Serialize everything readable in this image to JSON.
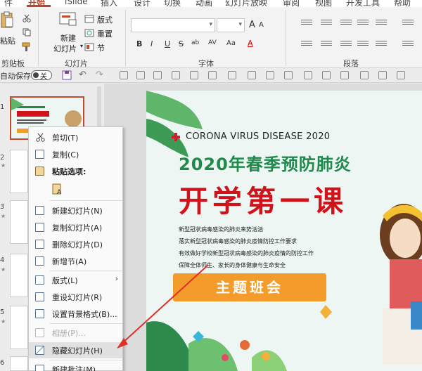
{
  "tabs": [
    "开始",
    "iSlide",
    "插入",
    "设计",
    "切换",
    "动画",
    "幻灯片放映",
    "审阅",
    "视图",
    "开发工具",
    "帮助"
  ],
  "ribbon": {
    "paste_label": "粘贴",
    "new_slide_label": [
      "新建",
      "幻灯片"
    ],
    "layout_label": "版式",
    "reset_label": "重置",
    "section_label": "节",
    "group_clipboard": "剪贴板",
    "group_slides": "幻灯片",
    "group_font": "字体",
    "group_paragraph": "段落",
    "format_buttons": [
      "B",
      "I",
      "U",
      "S",
      "ab",
      "AV",
      "Aa",
      "A"
    ]
  },
  "qat": {
    "autosave_label": "自动保存",
    "autosave_state": "关"
  },
  "slide_numbers": [
    "1",
    "2",
    "3",
    "4",
    "5",
    "6"
  ],
  "slide": {
    "banner": "CORONA VIRUS DISEASE 2020",
    "subtitle": "2020年春季预防肺炎",
    "title": "开学第一课",
    "lines": [
      "新型冠状病毒感染的肺炎来势汹汹",
      "落实新型冠状病毒感染的肺炎疫情防控工作要求",
      "有效做好学校新型冠状病毒感染的肺炎疫情的防控工作",
      "保障全体师生、家长的身体健康与生命安全"
    ],
    "button": "主题班会"
  },
  "menu": {
    "cut": "剪切(T)",
    "copy": "复制(C)",
    "paste_options": "粘贴选项:",
    "new_slide": "新建幻灯片(N)",
    "duplicate": "复制幻灯片(A)",
    "delete": "删除幻灯片(D)",
    "add_section": "新增节(A)",
    "layout": "版式(L)",
    "reset": "重设幻灯片(R)",
    "format_bg": "设置背景格式(B)...",
    "album": "相册(P)...",
    "hide": "隐藏幻灯片(H)",
    "new_comment": "新建批注(M)"
  },
  "colors": {
    "accent": "#b7472a",
    "slide_green": "#1f8a4c",
    "slide_red": "#d0121b",
    "slide_orange": "#f39c2b",
    "arrow_red": "#e0302a"
  }
}
